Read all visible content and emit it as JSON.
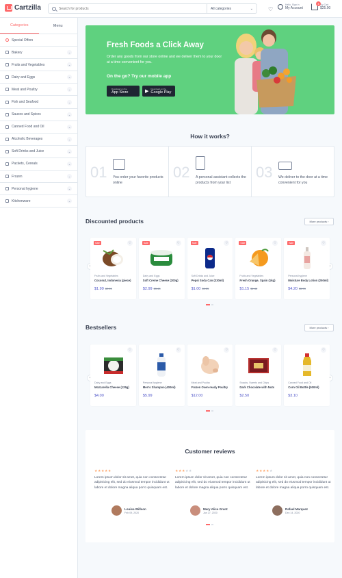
{
  "header": {
    "logo_text": "Cartzilla",
    "search_placeholder": "Search for products",
    "category_select": "All categories",
    "account_small": "Hello, Sign in",
    "account_big": "My Account",
    "cart_badge": "4",
    "cart_small": "My Cart",
    "cart_total": "$25.00"
  },
  "sidebar": {
    "tabs": [
      "Categories",
      "Menu"
    ],
    "items": [
      {
        "label": "Special Offers"
      },
      {
        "label": "Bakery"
      },
      {
        "label": "Fruits and Vegetables"
      },
      {
        "label": "Dairy and Eggs"
      },
      {
        "label": "Meat and Poultry"
      },
      {
        "label": "Fish and Seafood"
      },
      {
        "label": "Sauces and Spices"
      },
      {
        "label": "Canned Food and Oil"
      },
      {
        "label": "Alcoholic Beverages"
      },
      {
        "label": "Soft Drinks and Juice"
      },
      {
        "label": "Packets, Cereals"
      },
      {
        "label": "Frozen"
      },
      {
        "label": "Personal hygiene"
      },
      {
        "label": "Kitchenware"
      }
    ]
  },
  "hero": {
    "title": "Fresh Foods a Click Away",
    "text": "Order any goods from our store online and we deliver them to your door at a time convenient for you.",
    "sub": "On the go? Try our mobile app",
    "appstore_small": "Download on the",
    "appstore_big": "App Store",
    "gplay_small": "Download on the",
    "gplay_big": "Google Play"
  },
  "how": {
    "title": "How it works?",
    "steps": [
      {
        "num": "01",
        "text": "You order your favorite products online"
      },
      {
        "num": "02",
        "text": "A personal assistant collects the products from your list"
      },
      {
        "num": "03",
        "text": "We deliver to the door at a time convenient for you"
      }
    ]
  },
  "discounted": {
    "title": "Discounted products",
    "more": "More products",
    "sale_label": "Sale",
    "products": [
      {
        "cat": "Fruits and Vegetables",
        "name": "Coconut, Indonesia (piece)",
        "price": "$1.99",
        "old": "$2.15"
      },
      {
        "cat": "Dairy and Eggs",
        "name": "Soft Creme Cheese (200g)",
        "price": "$2.99",
        "old": "$3.45"
      },
      {
        "cat": "Soft Drinks and Juice",
        "name": "Pepsi Soda Can (330ml)",
        "price": "$1.00",
        "old": "$1.25"
      },
      {
        "cat": "Fruits and Vegetables",
        "name": "Fresh Orange, Spain (1kg)",
        "price": "$1.15",
        "old": "$1.45"
      },
      {
        "cat": "Personal hygiene",
        "name": "Moisture Body Lotion (250ml)",
        "price": "$4.20",
        "old": "$5.99"
      }
    ]
  },
  "bestsellers": {
    "title": "Bestsellers",
    "more": "More products",
    "products": [
      {
        "cat": "Dairy and Eggs",
        "name": "Mozzarella Cheese (125g)",
        "price": "$4.00"
      },
      {
        "cat": "Personal hygiene",
        "name": "Men's Shampoo (400ml)",
        "price": "$5.99"
      },
      {
        "cat": "Meat and Poultry",
        "name": "Frozen Oven-ready Poultry",
        "price": "$12.00"
      },
      {
        "cat": "Snacks, Sweets and Chips",
        "name": "Dark Chocolate with Nuts",
        "price": "$2.50"
      },
      {
        "cat": "Canned Food and Oil",
        "name": "Corn Oil Bottle (500ml)",
        "price": "$3.10"
      }
    ]
  },
  "reviews": {
    "title": "Customer reviews",
    "items": [
      {
        "rating": 5,
        "text": "Lorem ipsum dolor sit amet, quia non consectetur adipisicing elit, sed do eiusmod tempor incididunt ut labore et dolore magna aliqua porro quisquam est.",
        "name": "Louisa Willson",
        "date": "Feb 09, 2020"
      },
      {
        "rating": 3,
        "text": "Lorem ipsum dolor sit amet, quia non consectetur adipisicing elit, sed do eiusmod tempor incididunt ut labore et dolore magna aliqua porro quisquam est.",
        "name": "Mary Alice Grant",
        "date": "Jan 27, 2020"
      },
      {
        "rating": 4,
        "text": "Lorem ipsum dolor sit amet, quia non consectetur adipisicing elit, sed do eiusmod tempor incididunt ut labore et dolore magna aliqua porro quisquam est.",
        "name": "Rafael Marquez",
        "date": "Dec 14, 2020"
      }
    ]
  },
  "colors": {
    "accent": "#fe696a",
    "hero_bg": "#5fd17f",
    "price": "#4e54c8"
  }
}
